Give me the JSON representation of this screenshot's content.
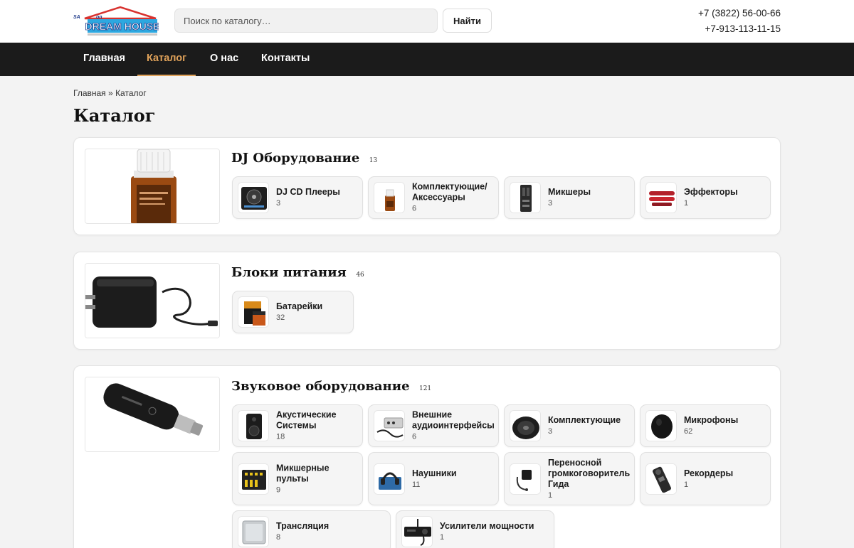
{
  "header": {
    "logo_text": "DREAM HOUSE",
    "search_placeholder": "Поиск по каталогу…",
    "search_button": "Найти",
    "phone_1": "+7 (3822) 56-00-66",
    "phone_2": "+7-913-113-11-15"
  },
  "nav": {
    "items": [
      {
        "label": "Главная"
      },
      {
        "label": "Каталог",
        "active": true
      },
      {
        "label": "О нас"
      },
      {
        "label": "Контакты"
      }
    ]
  },
  "breadcrumb": {
    "home": "Главная",
    "separator": "»",
    "current": "Каталог"
  },
  "page_title": "Каталог",
  "categories": [
    {
      "title": "DJ Оборудование",
      "count": "13",
      "subcategories": [
        {
          "name": "DJ CD Плееры",
          "count": "3"
        },
        {
          "name": "Комплектующие/ Аксессуары",
          "count": "6"
        },
        {
          "name": "Микшеры",
          "count": "3"
        },
        {
          "name": "Эффекторы",
          "count": "1"
        }
      ]
    },
    {
      "title": "Блоки питания",
      "count": "46",
      "subcategories": [
        {
          "name": "Батарейки",
          "count": "32"
        }
      ]
    },
    {
      "title": "Звуковое оборудование",
      "count": "121",
      "subcategories": [
        {
          "name": "Акустические Системы",
          "count": "18"
        },
        {
          "name": "Внешние аудиоинтерфейсы",
          "count": "6"
        },
        {
          "name": "Комплектующие",
          "count": "3"
        },
        {
          "name": "Микрофоны",
          "count": "62"
        },
        {
          "name": "Микшерные пульты",
          "count": "9"
        },
        {
          "name": "Наушники",
          "count": "11"
        },
        {
          "name": "Переносной громкоговоритель Гида",
          "count": "1"
        },
        {
          "name": "Рекордеры",
          "count": "1"
        },
        {
          "name": "Трансляция",
          "count": "8"
        },
        {
          "name": "Усилители мощности",
          "count": "1"
        }
      ]
    }
  ],
  "colors": {
    "nav_background": "#1b1b1b",
    "nav_active": "#e0a25a",
    "page_background": "#f3f3f3"
  }
}
